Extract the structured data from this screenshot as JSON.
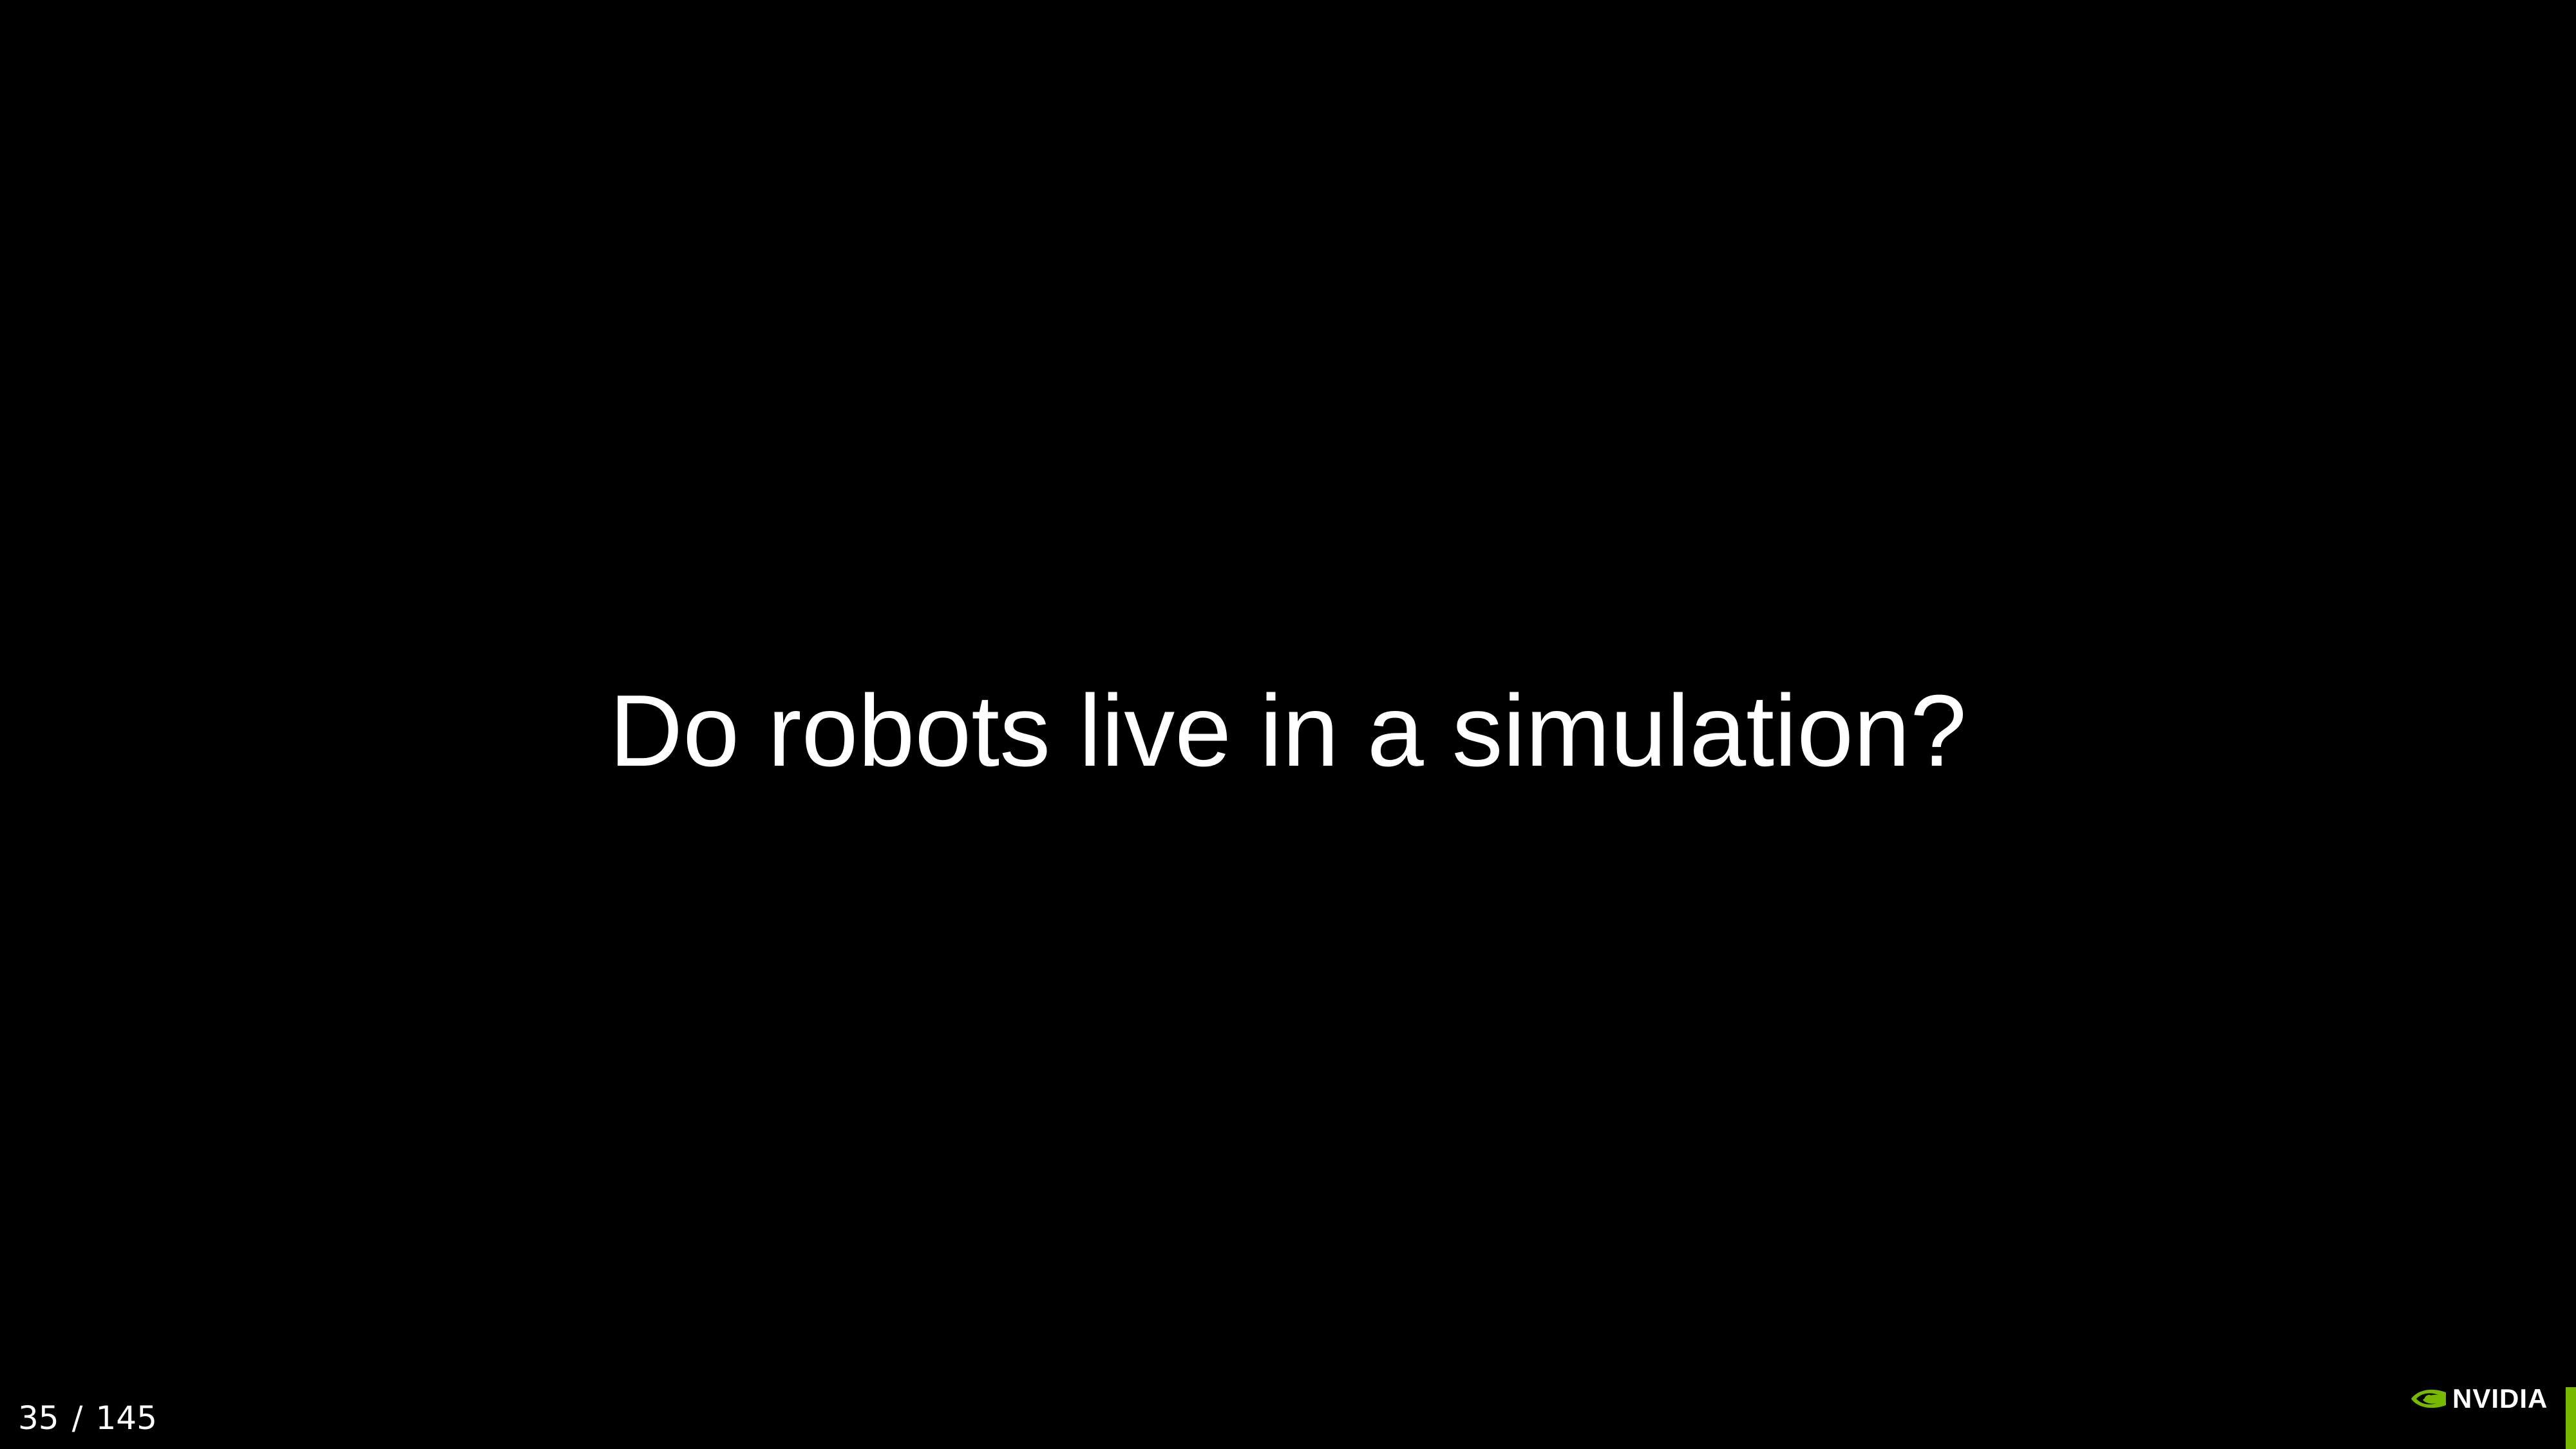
{
  "slide": {
    "title": "Do robots live in a simulation?",
    "counter": {
      "current": "35",
      "separator": "/",
      "total": "145"
    },
    "logo": {
      "icon": "nvidia-eye-icon",
      "text": "NVIDIA"
    }
  },
  "colors": {
    "background": "#000000",
    "text": "#ffffff",
    "accent": "#76b900"
  }
}
